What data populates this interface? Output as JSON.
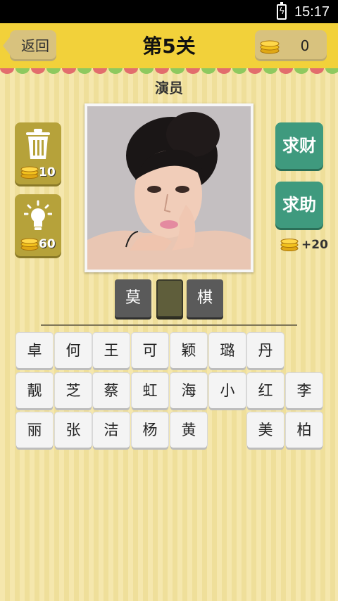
{
  "status_bar": {
    "time": "15:17",
    "battery_icon": "battery-charging-icon"
  },
  "header": {
    "back_label": "返回",
    "level_title": "第5关",
    "coins": "0"
  },
  "category": "演员",
  "tools": {
    "delete": {
      "icon": "trash-icon",
      "cost": "10"
    },
    "hint": {
      "icon": "lightbulb-icon",
      "cost": "60"
    }
  },
  "actions": {
    "ask_coins": "求财",
    "ask_help": "求助",
    "share_reward": "+20"
  },
  "answer_slots": [
    "莫",
    "",
    "棋"
  ],
  "letter_rows": [
    [
      "卓",
      "何",
      "王",
      "可",
      "颖",
      "璐",
      "丹",
      ""
    ],
    [
      "靓",
      "芝",
      "蔡",
      "虹",
      "海",
      "小",
      "红",
      "李"
    ],
    [
      "丽",
      "张",
      "洁",
      "杨",
      "黄",
      "",
      "美",
      "柏"
    ]
  ],
  "colors": {
    "header_yellow": "#f2d13a",
    "green_button": "#3f9a7e",
    "tool_olive": "#b6a23a",
    "background": "#f3e4a3"
  }
}
